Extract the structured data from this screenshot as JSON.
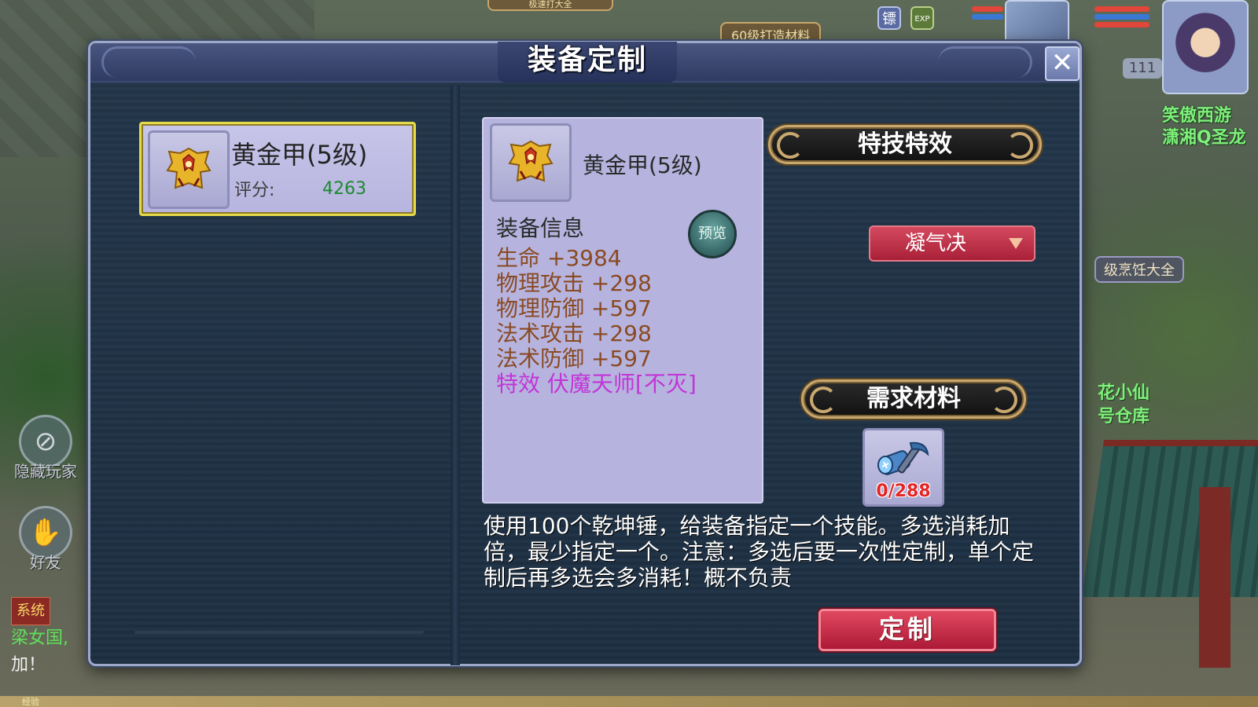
{
  "hud": {
    "top_banner": "极速打大全",
    "material_tag": "60级打造材料",
    "biao_icon": "镖",
    "exp_icon": "EXP",
    "level": "111",
    "server_name_line1": "笑傲西游",
    "server_name_line2": "潇湘Q圣龙",
    "npc_label": "级烹饪大全",
    "npc2_line1": "花小仙",
    "npc2_line2": "号仓库",
    "hide_players_label": "隐藏玩家",
    "friends_label": "好友",
    "exp_bar_label": "经验",
    "colors": {
      "hp": "#e0463a",
      "mp": "#3a78d6"
    }
  },
  "chat": {
    "system_tag": "系统",
    "line1": "梁女国,",
    "line2": "加！"
  },
  "dialog": {
    "title": "装备定制",
    "close_label": "✕"
  },
  "equipment_list": [
    {
      "name": "黄金甲(5级)",
      "score_label": "评分:",
      "score": "4263",
      "selected": true
    }
  ],
  "detail": {
    "name": "黄金甲(5级)",
    "info_header": "装备信息",
    "preview_label": "预览",
    "stats": [
      {
        "text": "生命 +3984"
      },
      {
        "text": "物理攻击 +298"
      },
      {
        "text": "物理防御 +597"
      },
      {
        "text": "法术攻击 +298"
      },
      {
        "text": "法术防御 +597"
      }
    ],
    "effect": "特效 伏魔天师[不灭]"
  },
  "skill_panel": {
    "banner": "特技特效",
    "selected_skill": "凝气决"
  },
  "materials": {
    "banner": "需求材料",
    "item_icon": "hammer-icon",
    "count": "0/288"
  },
  "description": "使用100个乾坤锤，给装备指定一个技能。多选消耗加倍，最少指定一个。注意：多选后要一次性定制，单个定制后再多选会多消耗！概不负责",
  "actions": {
    "customize_label": "定制"
  },
  "theme": {
    "accent_red": "#c22a44",
    "highlight_gold": "#e6d94a",
    "stat_color": "#8a4a22",
    "effect_color": "#c234d6",
    "score_color": "#1b8a2e"
  }
}
